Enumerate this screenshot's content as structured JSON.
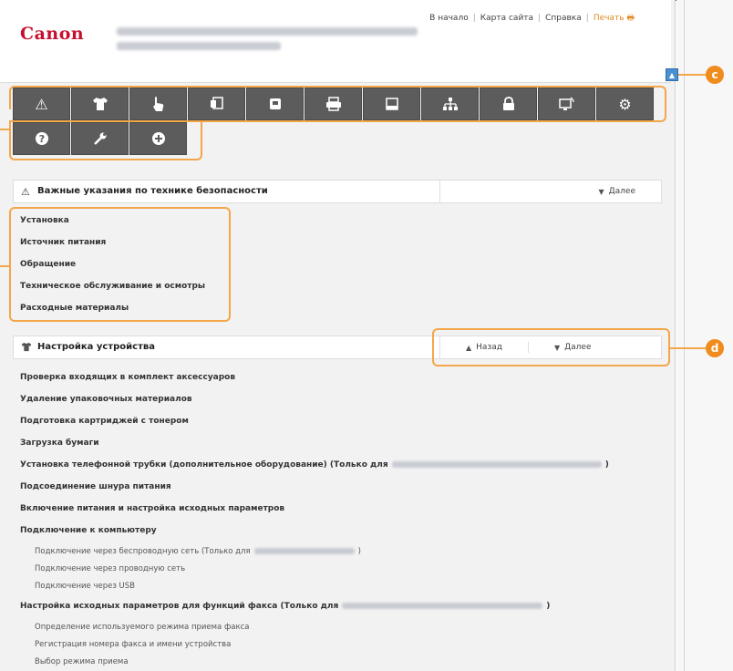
{
  "header": {
    "logo": "Canon",
    "links": [
      "В начало",
      "Карта сайта",
      "Справка"
    ],
    "print_label": "Печать"
  },
  "callouts": {
    "c": "c",
    "d": "d"
  },
  "toolbar": {
    "row1": [
      "warning-icon",
      "shirt-icon",
      "hand-icon",
      "copy-icon",
      "fax-icon",
      "printer-icon",
      "scanner-icon",
      "network-icon",
      "lock-icon",
      "remote-ui-icon",
      "settings-icon"
    ],
    "row2": [
      "help-icon",
      "wrench-icon",
      "plus-icon"
    ]
  },
  "safety": {
    "title": "Важные указания по технике безопасности",
    "next_label": "Далее",
    "links": [
      "Установка",
      "Источник питания",
      "Обращение",
      "Техническое обслуживание и осмотры",
      "Расходные материалы"
    ]
  },
  "setup": {
    "title": "Настройка устройства",
    "back_label": "Назад",
    "next_label": "Далее",
    "items": [
      {
        "text": "Проверка входящих в комплект аксессуаров",
        "level": 1
      },
      {
        "text": "Удаление упаковочных материалов",
        "level": 1
      },
      {
        "text": "Подготовка картриджей с тонером",
        "level": 1
      },
      {
        "text": "Загрузка бумаги",
        "level": 1
      },
      {
        "text": "Установка телефонной трубки (дополнительное оборудование) (Только для",
        "level": 1
      },
      {
        "text": "Подсоединение шнура питания",
        "level": 1
      },
      {
        "text": "Включение питания и настройка исходных параметров",
        "level": 1
      },
      {
        "text": "Подключение к компьютеру",
        "level": 1
      },
      {
        "text": "Подключение через беспроводную сеть (Только для",
        "level": 2
      },
      {
        "text": "Подключение через проводную сеть",
        "level": 2
      },
      {
        "text": "Подключение через USB",
        "level": 2
      },
      {
        "text": "Настройка исходных параметров для функций факса (Только для",
        "level": 1
      },
      {
        "text": "Определение используемого режима приема факса",
        "level": 2
      },
      {
        "text": "Регистрация номера факса и имени устройства",
        "level": 2
      },
      {
        "text": "Выбор режима приема",
        "level": 2
      }
    ]
  }
}
